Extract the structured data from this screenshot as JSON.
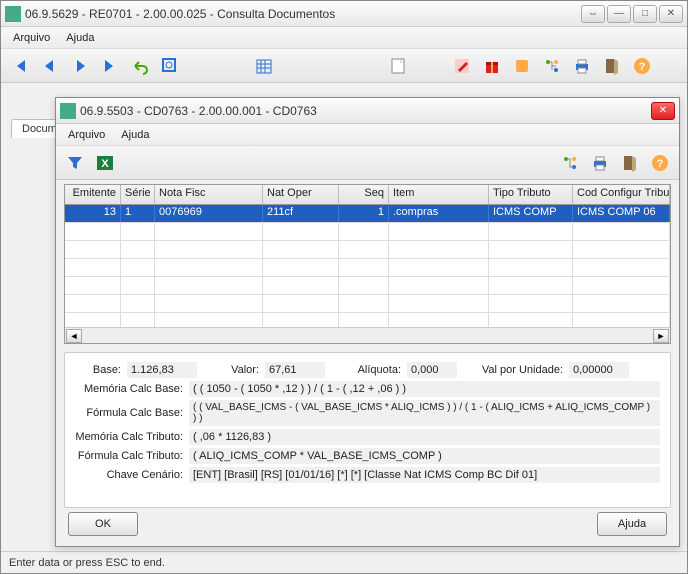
{
  "main_win": {
    "title": "06.9.5629 - RE0701 - 2.00.00.025 - Consulta Documentos",
    "menu": {
      "arquivo": "Arquivo",
      "ajuda": "Ajuda"
    },
    "tab_label": "Docum"
  },
  "dialog": {
    "title": "06.9.5503 - CD0763 - 2.00.00.001 - CD0763",
    "menu": {
      "arquivo": "Arquivo",
      "ajuda": "Ajuda"
    },
    "grid": {
      "cols": {
        "emitente": "Emitente",
        "serie": "Série",
        "nota": "Nota Fisc",
        "nat": "Nat Oper",
        "seq": "Seq",
        "item": "Item",
        "tipo": "Tipo Tributo",
        "cod": "Cod Configur Tribu"
      },
      "row": {
        "emitente": "13",
        "serie": "1",
        "nota": "0076969",
        "nat": "211cf",
        "seq": "1",
        "item": ".compras",
        "tipo": "ICMS COMP",
        "cod": "ICMS COMP 06"
      }
    },
    "fields": {
      "base_lbl": "Base:",
      "base_val": "1.126,83",
      "valor_lbl": "Valor:",
      "valor_val": "67,61",
      "aliq_lbl": "Alíquota:",
      "aliq_val": "0,000",
      "valun_lbl": "Val por Unidade:",
      "valun_val": "0,00000",
      "mem_base_lbl": "Memória Calc Base:",
      "mem_base_val": "( ( 1050 - ( 1050 * ,12 ) ) / ( 1 - ( ,12 + ,06 ) )",
      "form_base_lbl": "Fórmula Calc Base:",
      "form_base_val": "( ( VAL_BASE_ICMS - ( VAL_BASE_ICMS * ALIQ_ICMS ) ) / ( 1 - ( ALIQ_ICMS + ALIQ_ICMS_COMP ) ) )",
      "mem_trib_lbl": "Memória Calc Tributo:",
      "mem_trib_val": "( ,06 * 1126,83 )",
      "form_trib_lbl": "Fórmula Calc Tributo:",
      "form_trib_val": "( ALIQ_ICMS_COMP * VAL_BASE_ICMS_COMP )",
      "chave_lbl": "Chave Cenário:",
      "chave_val": "[ENT] [Brasil] [RS] [01/01/16] [*] [*] [Classe Nat ICMS Comp BC Dif 01]"
    },
    "buttons": {
      "ok": "OK",
      "ajuda": "Ajuda"
    }
  },
  "status": "Enter data or press ESC to end."
}
